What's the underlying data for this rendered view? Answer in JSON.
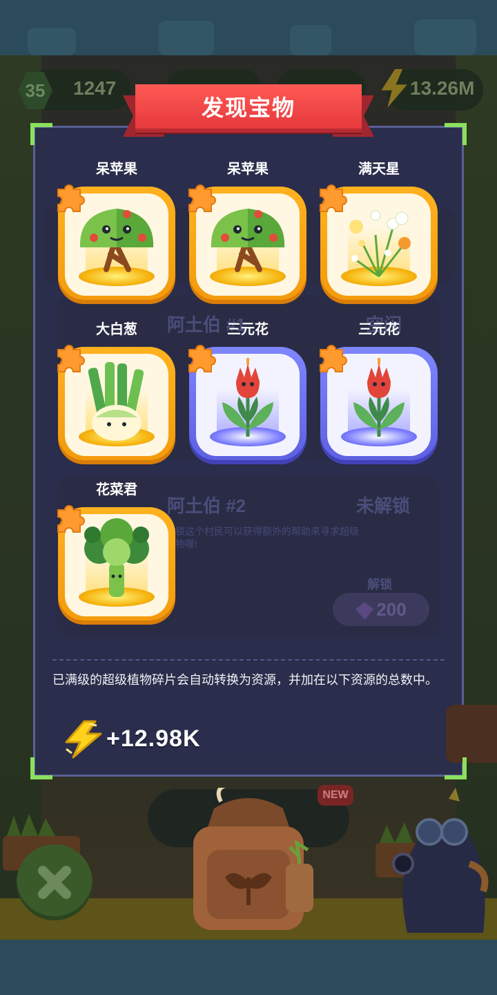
{
  "hud": {
    "level": "35",
    "seeds": "1247",
    "energy": "13.26M"
  },
  "dialog": {
    "title": "发现宝物",
    "items": [
      {
        "name": "呆苹果",
        "rarity": "gold",
        "plant": "apple-tree"
      },
      {
        "name": "呆苹果",
        "rarity": "gold",
        "plant": "apple-tree"
      },
      {
        "name": "满天星",
        "rarity": "gold",
        "plant": "babys-breath"
      },
      {
        "name": "大白葱",
        "rarity": "gold",
        "plant": "leek"
      },
      {
        "name": "三元花",
        "rarity": "blue",
        "plant": "trinity-flower"
      },
      {
        "name": "三元花",
        "rarity": "blue",
        "plant": "trinity-flower"
      },
      {
        "name": "花菜君",
        "rarity": "gold",
        "plant": "broccoli"
      }
    ],
    "info_text": "已满级的超级植物碎片会自动转换为资源，并加在以下资源的总数中。",
    "reward_value": "+12.98K"
  },
  "background": {
    "village1_title": "阿土伯 #1",
    "village1_status": "空闲",
    "village2_title": "阿土伯 #2",
    "village2_status": "未解锁",
    "village2_desc": "解锁这个村民可以获得额外的帮助来寻求超级植物喔!",
    "unlock_label": "解锁",
    "unlock_cost": "200",
    "new_badge": "NEW"
  },
  "colors": {
    "banner": "#e6393d",
    "gold_frame": "#ffb21f",
    "blue_frame": "#7e86ff",
    "corner_accent": "#8be05e",
    "dialog_bg": "#2b2e4e"
  }
}
